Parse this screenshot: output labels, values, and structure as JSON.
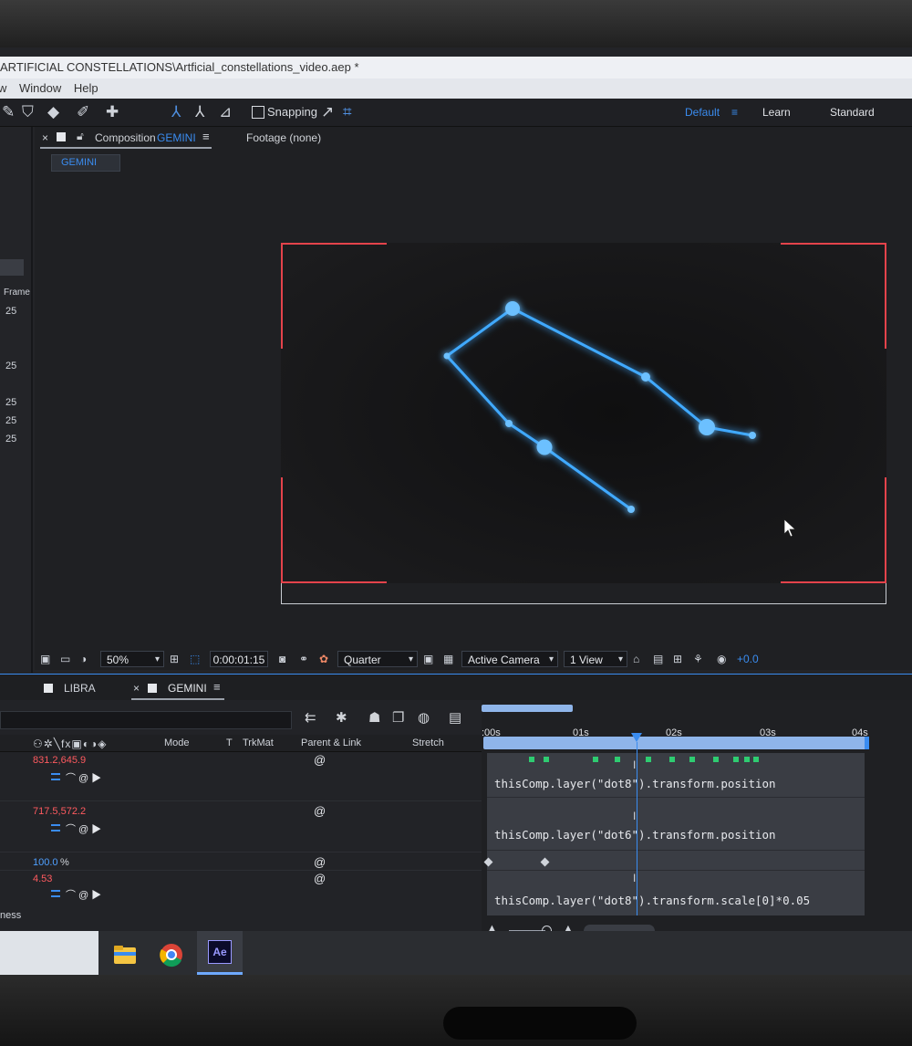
{
  "window": {
    "title": "ARTIFICIAL CONSTELLATIONS\\Artficial_constellations_video.aep *",
    "menus": [
      "w",
      "Window",
      "Help"
    ]
  },
  "toolbar": {
    "snapping_label": "Snapping",
    "workspaces": [
      "Default",
      "Learn",
      "Standard"
    ],
    "active_workspace": "Default"
  },
  "left_panel": {
    "column_label": "Frame",
    "values": [
      "25",
      "25",
      "25",
      "25",
      "25"
    ]
  },
  "composition_panel": {
    "tab_label": "Composition",
    "comp_name": "GEMINI",
    "footage_label": "Footage",
    "footage_value": "(none)",
    "flowchart_chip": "GEMINI"
  },
  "viewer_toolbar": {
    "zoom": "50%",
    "timecode": "0:00:01:15",
    "resolution": "Quarter",
    "camera": "Active Camera",
    "views": "1 View",
    "exposure": "+0.0"
  },
  "timeline": {
    "tabs": [
      "LIBRA",
      "GEMINI"
    ],
    "active_tab": "GEMINI",
    "column_headers": {
      "mode": "Mode",
      "t": "T",
      "trkmat": "TrkMat",
      "parent": "Parent & Link",
      "stretch": "Stretch"
    },
    "ruler_labels": [
      ":00s",
      "01s",
      "02s",
      "03s",
      "04s"
    ],
    "rows": [
      {
        "value": "831.2,645.9",
        "expression": "thisComp.layer(\"dot8\").transform.position"
      },
      {
        "value": "717.5,572.2",
        "expression": "thisComp.layer(\"dot6\").transform.position"
      },
      {
        "value": "100.0",
        "unit": "%",
        "expression": ""
      },
      {
        "value": "4.53",
        "expression": "thisComp.layer(\"dot8\").transform.scale[0]*0.05"
      }
    ],
    "partial_label": "ness"
  },
  "colors": {
    "accent": "#3a8cf0",
    "property_value_red": "#ff5a5f",
    "constellation_glow": "#3fa9ff",
    "safe_zone": "#e4434b"
  },
  "taskbar": {
    "apps": [
      "folder-icon",
      "chrome-icon",
      "after-effects-icon"
    ],
    "ae_label": "Ae"
  }
}
